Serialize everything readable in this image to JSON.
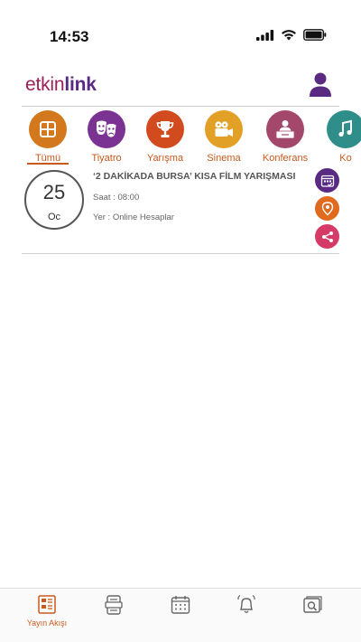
{
  "status_bar": {
    "time": "14:53"
  },
  "header": {
    "logo_part1": "etkin",
    "logo_part2": "link"
  },
  "categories": [
    {
      "label": "Tümü",
      "color": "#d3781c",
      "icon": "grid-icon",
      "selected": true
    },
    {
      "label": "Tiyatro",
      "color": "#7b3393",
      "icon": "theatre-masks-icon"
    },
    {
      "label": "Yarışma",
      "color": "#d24b1f",
      "icon": "trophy-icon"
    },
    {
      "label": "Sinema",
      "color": "#e3a026",
      "icon": "film-camera-icon"
    },
    {
      "label": "Konferans",
      "color": "#a3486b",
      "icon": "presenter-icon"
    },
    {
      "label": "Ko",
      "color": "#2f8e8a",
      "icon": "music-icon"
    }
  ],
  "event": {
    "day": "25",
    "month": "Oc",
    "title": "‘2 DAKİKADA BURSA’ KISA FİLM YARIŞMASI",
    "time": "Saat : 08:00",
    "place": "Yer : Online Hesaplar"
  },
  "event_actions": [
    {
      "icon": "calendar-add-icon",
      "color": "#5a2a83"
    },
    {
      "icon": "location-pin-icon",
      "color": "#e06a1e"
    },
    {
      "icon": "share-icon",
      "color": "#d63a67"
    }
  ],
  "bottom_nav": [
    {
      "label": "Yayın Akışı",
      "icon": "feed-icon",
      "active": true
    },
    {
      "label": "",
      "icon": "ticket-icon"
    },
    {
      "label": "",
      "icon": "calendar-icon"
    },
    {
      "label": "",
      "icon": "bell-icon"
    },
    {
      "label": "",
      "icon": "gallery-search-icon"
    }
  ]
}
